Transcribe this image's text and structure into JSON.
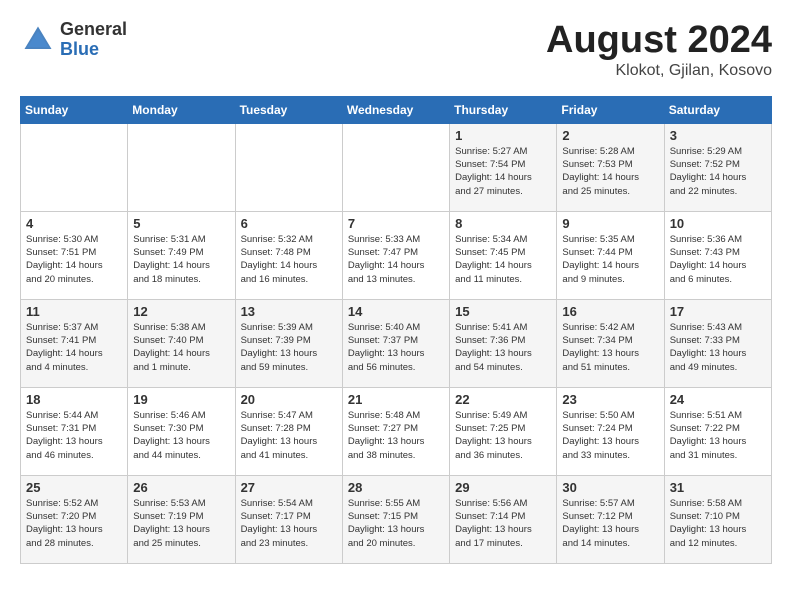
{
  "header": {
    "logo_general": "General",
    "logo_blue": "Blue",
    "month_year": "August 2024",
    "location": "Klokot, Gjilan, Kosovo"
  },
  "days_of_week": [
    "Sunday",
    "Monday",
    "Tuesday",
    "Wednesday",
    "Thursday",
    "Friday",
    "Saturday"
  ],
  "weeks": [
    [
      {
        "day": "",
        "info": ""
      },
      {
        "day": "",
        "info": ""
      },
      {
        "day": "",
        "info": ""
      },
      {
        "day": "",
        "info": ""
      },
      {
        "day": "1",
        "info": "Sunrise: 5:27 AM\nSunset: 7:54 PM\nDaylight: 14 hours\nand 27 minutes."
      },
      {
        "day": "2",
        "info": "Sunrise: 5:28 AM\nSunset: 7:53 PM\nDaylight: 14 hours\nand 25 minutes."
      },
      {
        "day": "3",
        "info": "Sunrise: 5:29 AM\nSunset: 7:52 PM\nDaylight: 14 hours\nand 22 minutes."
      }
    ],
    [
      {
        "day": "4",
        "info": "Sunrise: 5:30 AM\nSunset: 7:51 PM\nDaylight: 14 hours\nand 20 minutes."
      },
      {
        "day": "5",
        "info": "Sunrise: 5:31 AM\nSunset: 7:49 PM\nDaylight: 14 hours\nand 18 minutes."
      },
      {
        "day": "6",
        "info": "Sunrise: 5:32 AM\nSunset: 7:48 PM\nDaylight: 14 hours\nand 16 minutes."
      },
      {
        "day": "7",
        "info": "Sunrise: 5:33 AM\nSunset: 7:47 PM\nDaylight: 14 hours\nand 13 minutes."
      },
      {
        "day": "8",
        "info": "Sunrise: 5:34 AM\nSunset: 7:45 PM\nDaylight: 14 hours\nand 11 minutes."
      },
      {
        "day": "9",
        "info": "Sunrise: 5:35 AM\nSunset: 7:44 PM\nDaylight: 14 hours\nand 9 minutes."
      },
      {
        "day": "10",
        "info": "Sunrise: 5:36 AM\nSunset: 7:43 PM\nDaylight: 14 hours\nand 6 minutes."
      }
    ],
    [
      {
        "day": "11",
        "info": "Sunrise: 5:37 AM\nSunset: 7:41 PM\nDaylight: 14 hours\nand 4 minutes."
      },
      {
        "day": "12",
        "info": "Sunrise: 5:38 AM\nSunset: 7:40 PM\nDaylight: 14 hours\nand 1 minute."
      },
      {
        "day": "13",
        "info": "Sunrise: 5:39 AM\nSunset: 7:39 PM\nDaylight: 13 hours\nand 59 minutes."
      },
      {
        "day": "14",
        "info": "Sunrise: 5:40 AM\nSunset: 7:37 PM\nDaylight: 13 hours\nand 56 minutes."
      },
      {
        "day": "15",
        "info": "Sunrise: 5:41 AM\nSunset: 7:36 PM\nDaylight: 13 hours\nand 54 minutes."
      },
      {
        "day": "16",
        "info": "Sunrise: 5:42 AM\nSunset: 7:34 PM\nDaylight: 13 hours\nand 51 minutes."
      },
      {
        "day": "17",
        "info": "Sunrise: 5:43 AM\nSunset: 7:33 PM\nDaylight: 13 hours\nand 49 minutes."
      }
    ],
    [
      {
        "day": "18",
        "info": "Sunrise: 5:44 AM\nSunset: 7:31 PM\nDaylight: 13 hours\nand 46 minutes."
      },
      {
        "day": "19",
        "info": "Sunrise: 5:46 AM\nSunset: 7:30 PM\nDaylight: 13 hours\nand 44 minutes."
      },
      {
        "day": "20",
        "info": "Sunrise: 5:47 AM\nSunset: 7:28 PM\nDaylight: 13 hours\nand 41 minutes."
      },
      {
        "day": "21",
        "info": "Sunrise: 5:48 AM\nSunset: 7:27 PM\nDaylight: 13 hours\nand 38 minutes."
      },
      {
        "day": "22",
        "info": "Sunrise: 5:49 AM\nSunset: 7:25 PM\nDaylight: 13 hours\nand 36 minutes."
      },
      {
        "day": "23",
        "info": "Sunrise: 5:50 AM\nSunset: 7:24 PM\nDaylight: 13 hours\nand 33 minutes."
      },
      {
        "day": "24",
        "info": "Sunrise: 5:51 AM\nSunset: 7:22 PM\nDaylight: 13 hours\nand 31 minutes."
      }
    ],
    [
      {
        "day": "25",
        "info": "Sunrise: 5:52 AM\nSunset: 7:20 PM\nDaylight: 13 hours\nand 28 minutes."
      },
      {
        "day": "26",
        "info": "Sunrise: 5:53 AM\nSunset: 7:19 PM\nDaylight: 13 hours\nand 25 minutes."
      },
      {
        "day": "27",
        "info": "Sunrise: 5:54 AM\nSunset: 7:17 PM\nDaylight: 13 hours\nand 23 minutes."
      },
      {
        "day": "28",
        "info": "Sunrise: 5:55 AM\nSunset: 7:15 PM\nDaylight: 13 hours\nand 20 minutes."
      },
      {
        "day": "29",
        "info": "Sunrise: 5:56 AM\nSunset: 7:14 PM\nDaylight: 13 hours\nand 17 minutes."
      },
      {
        "day": "30",
        "info": "Sunrise: 5:57 AM\nSunset: 7:12 PM\nDaylight: 13 hours\nand 14 minutes."
      },
      {
        "day": "31",
        "info": "Sunrise: 5:58 AM\nSunset: 7:10 PM\nDaylight: 13 hours\nand 12 minutes."
      }
    ]
  ]
}
